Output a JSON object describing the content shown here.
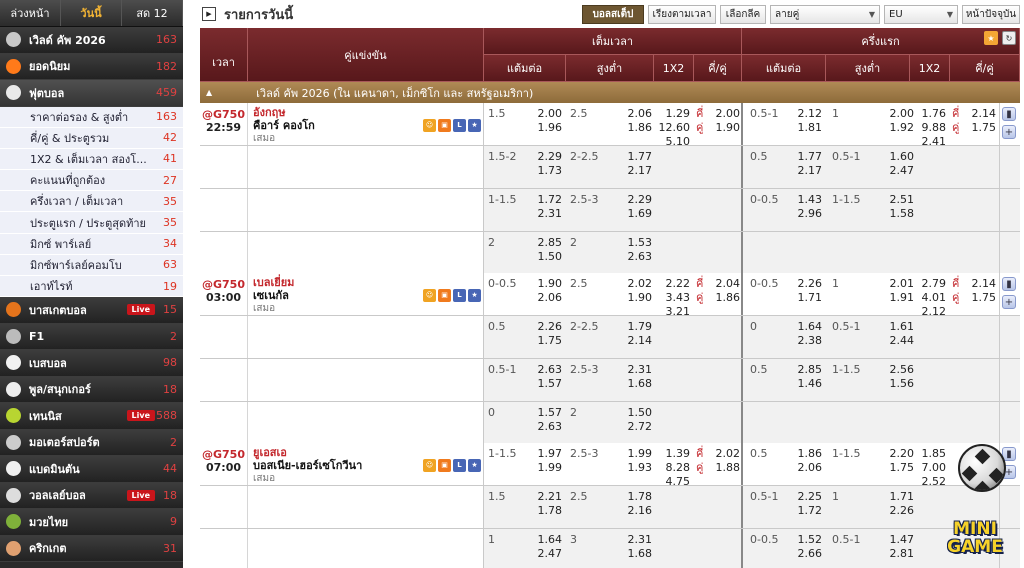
{
  "sidebar": {
    "tabs": [
      {
        "label": "ล่วงหน้า",
        "active": false
      },
      {
        "label": "วันนี้",
        "active": true
      },
      {
        "label": "สด 12",
        "active": false
      }
    ],
    "top": [
      {
        "label": "เวิลด์ คัพ 2026",
        "count": "163",
        "icon": "trophy-icon",
        "color": "#c8c8c8"
      },
      {
        "label": "ยอดนิยม",
        "count": "182",
        "icon": "fire-icon",
        "color": "#ff7a1a"
      },
      {
        "label": "ฟุตบอล",
        "count": "459",
        "icon": "soccer-ball-icon",
        "color": "#e9e9e9"
      }
    ],
    "football_sub": [
      {
        "label": "ราคาต่อรอง & สูงต่ำ",
        "count": "163"
      },
      {
        "label": "คี่/คู่ & ประตูรวม",
        "count": "42"
      },
      {
        "label": "1X2 & เต็มเวลา สองโ...",
        "count": "41"
      },
      {
        "label": "คะแนนที่ถูกต้อง",
        "count": "27"
      },
      {
        "label": "ครึ่งเวลา / เต็มเวลา",
        "count": "35"
      },
      {
        "label": "ประตูแรก / ประตูสุดท้าย",
        "count": "35"
      },
      {
        "label": "มิกซ์ พาร์เลย์",
        "count": "34"
      },
      {
        "label": "มิกซ์พาร์เลย์คอมโบ",
        "count": "63"
      },
      {
        "label": "เอาท์ไรท์",
        "count": "19"
      }
    ],
    "sports": [
      {
        "label": "บาสเกตบอล",
        "count": "15",
        "live": "Live",
        "icon": "basketball-icon",
        "color": "#e5741c"
      },
      {
        "label": "F1",
        "count": "2",
        "live": "",
        "icon": "f1-car-icon",
        "color": "#bbbbbb"
      },
      {
        "label": "เบสบอล",
        "count": "98",
        "live": "",
        "icon": "baseball-icon",
        "color": "#f2f2f2"
      },
      {
        "label": "พูล/สนุกเกอร์",
        "count": "18",
        "live": "",
        "icon": "pool-ball-icon",
        "color": "#eeeeee"
      },
      {
        "label": "เทนนิส",
        "count": "588",
        "live": "Live",
        "icon": "tennis-ball-icon",
        "color": "#b8d531"
      },
      {
        "label": "มอเตอร์สปอร์ต",
        "count": "2",
        "live": "",
        "icon": "motorsport-icon",
        "color": "#cccccc"
      },
      {
        "label": "แบดมินตัน",
        "count": "44",
        "live": "",
        "icon": "shuttlecock-icon",
        "color": "#f0f0f0"
      },
      {
        "label": "วอลเลย์บอล",
        "count": "18",
        "live": "Live",
        "icon": "volleyball-icon",
        "color": "#dddddd"
      },
      {
        "label": "มวยไทย",
        "count": "9",
        "live": "",
        "icon": "muay-thai-icon",
        "color": "#7fb13a"
      },
      {
        "label": "คริกเกต",
        "count": "31",
        "live": "",
        "icon": "cricket-bat-icon",
        "color": "#e0a070"
      }
    ]
  },
  "topbar": {
    "title": "รายการวันนี้",
    "btn_big_ball": "บอลสเต็ป",
    "btn_sort_time": "เรียงตามเวลา",
    "btn_select_league": "เลือกลีค",
    "select_pairs": "ลายคู่",
    "select_odds": "EU",
    "btn_today": "หน้าปัจจุบัน"
  },
  "table": {
    "hdr_time": "เวลา",
    "hdr_match": "คู่แข่งขัน",
    "hdr_full": "เต็มเวลา",
    "hdr_half": "ครึ่งแรก",
    "sub": [
      "แต้มต่อ",
      "สูงต่ำ",
      "1X2",
      "คี่/คู่",
      "แต้มต่อ",
      "สูงต่ำ",
      "1X2",
      "คี่/คู่"
    ],
    "league": "เวิลด์ คัพ 2026 (ใน แคนาดา, เม็กซิโก และ สหรัฐอเมริกา)"
  },
  "matches": [
    {
      "code": "@G750",
      "time": "22:59",
      "fav": "อังกฤษ",
      "dog": "คือาร์ คองโก",
      "draw": "เสมอ",
      "rows": [
        {
          "fh": "1.5",
          "fh1": "2.00",
          "fh2": "1.96",
          "fo": "2.5",
          "fo1": "2.06",
          "fo2": "1.86",
          "x1": "1.29",
          "x2": "12.60",
          "x3": "5.10",
          "oe_o": "คี่",
          "oe_o1": "2.00",
          "oe_e": "คู่",
          "oe_e1": "1.90",
          "hh": "0.5-1",
          "hh1": "2.12",
          "hh2": "1.81",
          "ho": "1",
          "ho1": "2.00",
          "ho2": "1.92",
          "hx1": "1.76",
          "hx2": "9.88",
          "hx3": "2.41",
          "ho_o": "คี่",
          "ho_o1": "2.14",
          "ho_e": "คู่",
          "ho_e1": "1.75"
        },
        {
          "fh": "1.5-2",
          "fh1": "2.29",
          "fh2": "1.73",
          "fo": "2-2.5",
          "fo1": "1.77",
          "fo2": "2.17",
          "hh": "0.5",
          "hh1": "1.77",
          "hh2": "2.17",
          "ho": "0.5-1",
          "ho1": "1.60",
          "ho2": "2.47"
        },
        {
          "fh": "1-1.5",
          "fh1": "1.72",
          "fh2": "2.31",
          "fo": "2.5-3",
          "fo1": "2.29",
          "fo2": "1.69",
          "hh": "0-0.5",
          "hh1": "1.43",
          "hh2": "2.96",
          "ho": "1-1.5",
          "ho1": "2.51",
          "ho2": "1.58"
        },
        {
          "fh": "2",
          "fh1": "2.85",
          "fh2": "1.50",
          "fo": "2",
          "fo1": "1.53",
          "fo2": "2.63"
        }
      ]
    },
    {
      "code": "@G750",
      "time": "03:00",
      "fav": "เบลเยี่ยม",
      "dog": "เซเนกัล",
      "draw": "เสมอ",
      "rows": [
        {
          "fh": "0-0.5",
          "fh1": "1.90",
          "fh2": "2.06",
          "fo": "2.5",
          "fo1": "2.02",
          "fo2": "1.90",
          "x1": "2.22",
          "x2": "3.43",
          "x3": "3.21",
          "oe_o": "คี่",
          "oe_o1": "2.04",
          "oe_e": "คู่",
          "oe_e1": "1.86",
          "hh": "0-0.5",
          "hh1": "2.26",
          "hh2": "1.71",
          "ho": "1",
          "ho1": "2.01",
          "ho2": "1.91",
          "hx1": "2.79",
          "hx2": "4.01",
          "hx3": "2.12",
          "ho_o": "คี่",
          "ho_o1": "2.14",
          "ho_e": "คู่",
          "ho_e1": "1.75"
        },
        {
          "fh": "0.5",
          "fh1": "2.26",
          "fh2": "1.75",
          "fo": "2-2.5",
          "fo1": "1.79",
          "fo2": "2.14",
          "hh": "0",
          "hh1": "1.64",
          "hh2": "2.38",
          "ho": "0.5-1",
          "ho1": "1.61",
          "ho2": "2.44"
        },
        {
          "fh": "0.5-1",
          "fh1": "2.63",
          "fh2": "1.57",
          "fo": "2.5-3",
          "fo1": "2.31",
          "fo2": "1.68",
          "hh": "0.5",
          "hh1": "2.85",
          "hh2": "1.46",
          "ho": "1-1.5",
          "ho1": "2.56",
          "ho2": "1.56"
        },
        {
          "fh": "0",
          "fh1": "1.57",
          "fh2": "2.63",
          "fo": "2",
          "fo1": "1.50",
          "fo2": "2.72"
        }
      ]
    },
    {
      "code": "@G750",
      "time": "07:00",
      "fav": "ยูเอสเอ",
      "dog": "บอสเนีย-เฮอร์เซโกวีนา",
      "draw": "เสมอ",
      "rows": [
        {
          "fh": "1-1.5",
          "fh1": "1.97",
          "fh2": "1.99",
          "fo": "2.5-3",
          "fo1": "1.99",
          "fo2": "1.93",
          "x1": "1.39",
          "x2": "8.28",
          "x3": "4.75",
          "oe_o": "คี่",
          "oe_o1": "2.02",
          "oe_e": "คู่",
          "oe_e1": "1.88",
          "hh": "0.5",
          "hh1": "1.86",
          "hh2": "2.06",
          "ho": "1-1.5",
          "ho1": "2.20",
          "ho2": "1.75",
          "hx1": "1.85",
          "hx2": "7.00",
          "hx3": "2.52",
          "ho_o": "",
          "ho_o1": "",
          "ho_e": "",
          "ho_e1": ""
        },
        {
          "fh": "1.5",
          "fh1": "2.21",
          "fh2": "1.78",
          "fo": "2.5",
          "fo1": "1.78",
          "fo2": "2.16",
          "hh": "0.5-1",
          "hh1": "2.25",
          "hh2": "1.72",
          "ho": "1",
          "ho1": "1.71",
          "ho2": "2.26"
        },
        {
          "fh": "1",
          "fh1": "1.64",
          "fh2": "2.47",
          "fo": "3",
          "fo1": "2.31",
          "fo2": "1.68",
          "hh": "0-0.5",
          "hh1": "1.52",
          "hh2": "2.66",
          "ho": "0.5-1",
          "ho1": "1.47",
          "ho2": "2.81"
        }
      ]
    }
  ],
  "overlay": {
    "mini_game_line1": "MINI",
    "mini_game_line2": "GAME"
  }
}
